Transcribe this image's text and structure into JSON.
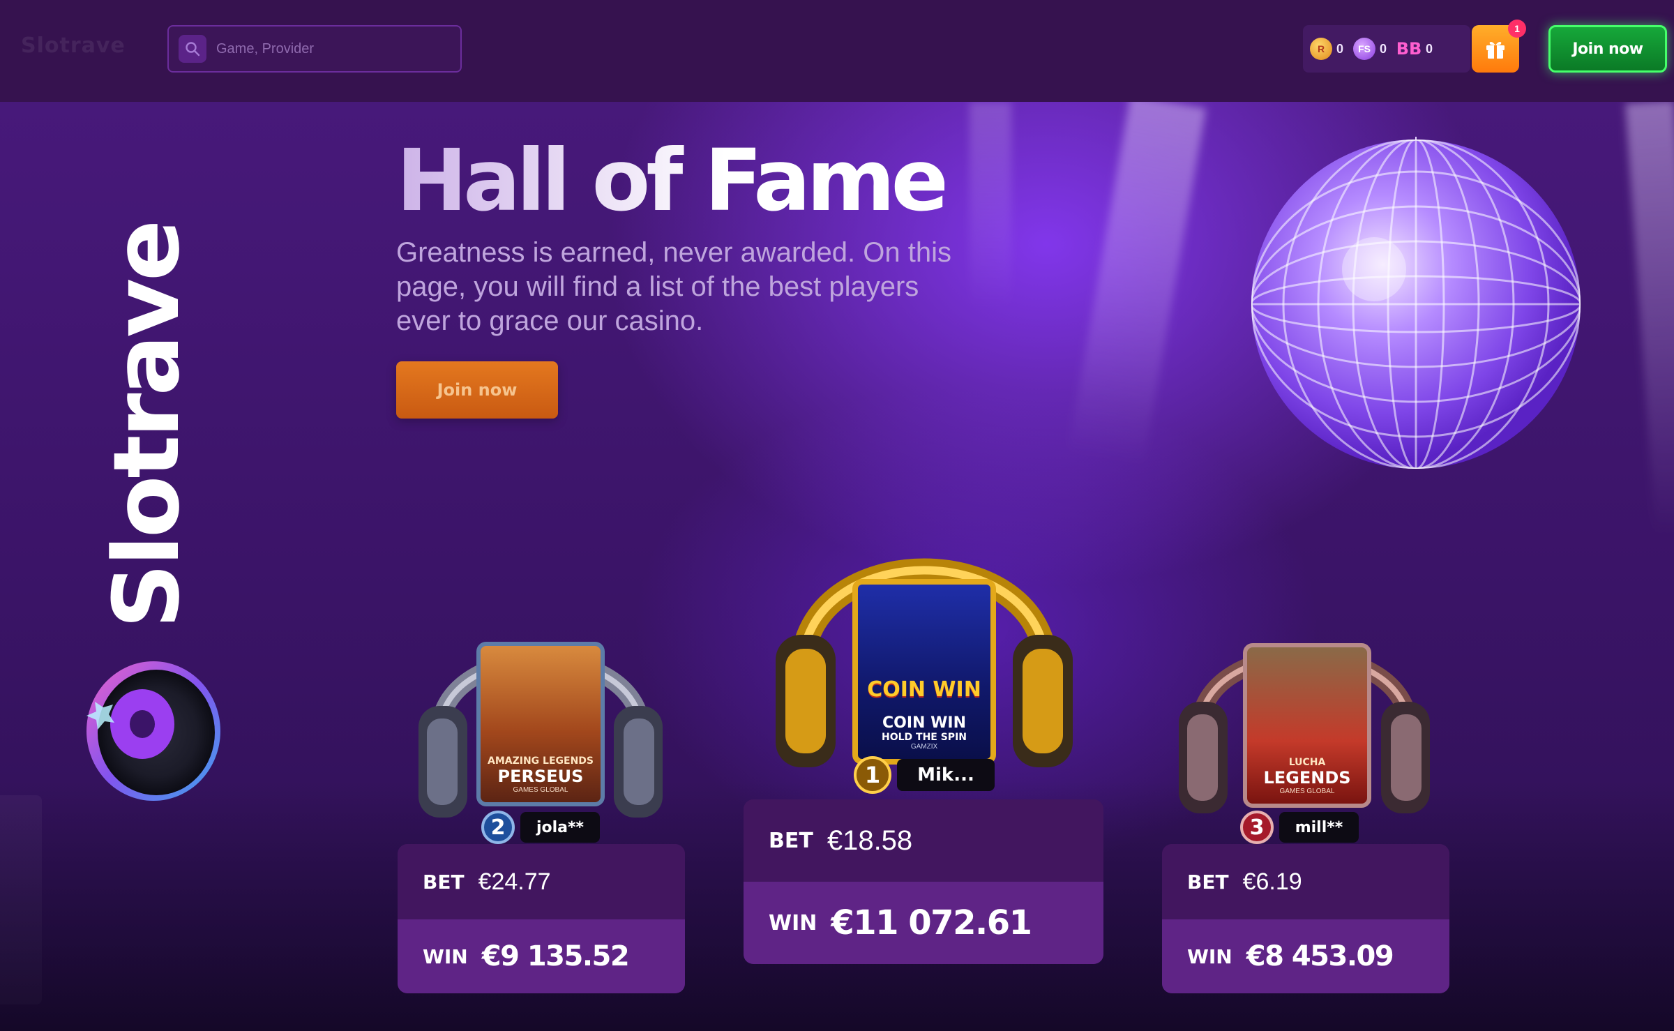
{
  "header": {
    "logo_text": "Slotrave",
    "search_placeholder": "Game, Provider",
    "wallet": [
      {
        "icon": "rb-coin-icon",
        "value": "0"
      },
      {
        "icon": "fs-coin-icon",
        "value": "0"
      },
      {
        "icon": "bb-bonus-icon",
        "value": "0"
      }
    ],
    "gift_badge": "1",
    "join_label": "Join now"
  },
  "brand": {
    "vertical_text": "Slotrave"
  },
  "hero": {
    "title": "Hall of Fame",
    "subtitle": "Greatness is earned, never awarded. On this page, you will find a list of the best players ever to grace our casino.",
    "join_label": "Join now"
  },
  "podium": [
    {
      "rank": "2",
      "player": "jola**",
      "game_sub": "AMAZING LEGENDS",
      "game_name": "PERSEUS",
      "provider": "GAMES GLOBAL",
      "bet_label": "BET",
      "bet": "€24.77",
      "win_label": "WIN",
      "win": "€9 135.52",
      "headset_color": "silver"
    },
    {
      "rank": "1",
      "player": "Mik...",
      "game_logo": "COIN WIN",
      "game_name": "COIN WIN",
      "game_sub": "HOLD THE SPIN",
      "provider": "GAMZIX",
      "bet_label": "BET",
      "bet": "€18.58",
      "win_label": "WIN",
      "win": "€11 072.61",
      "headset_color": "gold"
    },
    {
      "rank": "3",
      "player": "mill**",
      "game_sub": "LUCHA",
      "game_name": "LEGENDS",
      "provider": "GAMES GLOBAL",
      "bet_label": "BET",
      "bet": "€6.19",
      "win_label": "WIN",
      "win": "€8 453.09",
      "headset_color": "bronze"
    }
  ],
  "colors": {
    "accent_orange": "#ff8a1c",
    "accent_green": "#46ff6b",
    "gold": "#f2b820",
    "background": "#3a1660"
  }
}
